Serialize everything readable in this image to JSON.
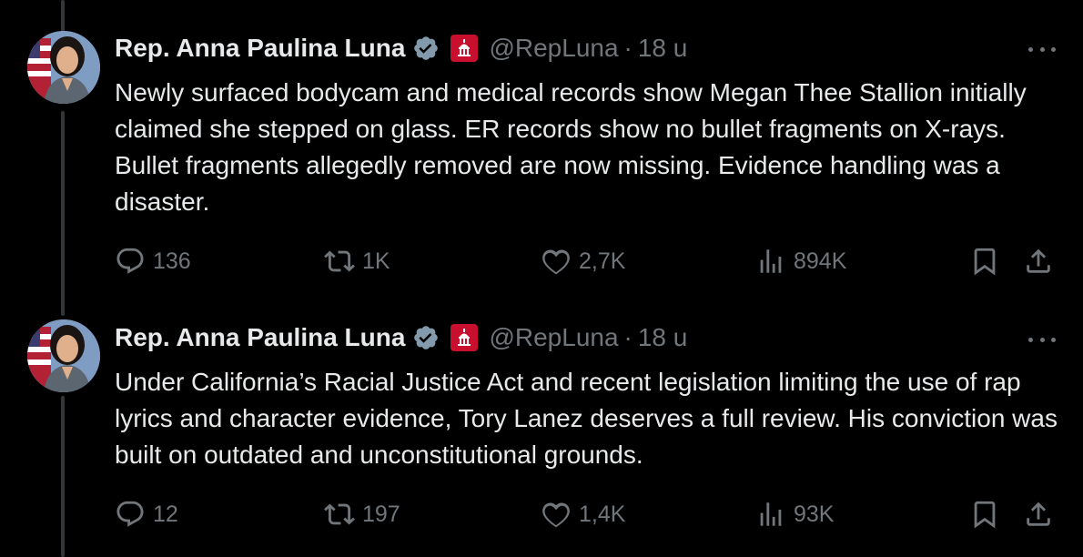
{
  "tweets": [
    {
      "name": "Rep. Anna Paulina Luna",
      "handle": "@RepLuna",
      "separator": "·",
      "time": "18 u",
      "text": "Newly surfaced bodycam and medical records show Megan Thee Stallion initially claimed she stepped on glass. ER records show no bullet fragments on X-rays. Bullet fragments allegedly removed are now missing. Evidence handling was a disaster.",
      "replies": "136",
      "reposts": "1K",
      "likes": "2,7K",
      "views": "894K"
    },
    {
      "name": "Rep. Anna Paulina Luna",
      "handle": "@RepLuna",
      "separator": "·",
      "time": "18 u",
      "text": "Under California’s Racial Justice Act and recent legislation limiting the use of rap lyrics and character evidence, Tory Lanez deserves a full review. His conviction was built on outdated and unconstitutional grounds.",
      "replies": "12",
      "reposts": "197",
      "likes": "1,4K",
      "views": "93K"
    }
  ],
  "icons": {
    "more": "more-dots-icon",
    "verified": "verified-badge-icon",
    "government": "capitol-flag-icon",
    "reply": "reply-icon",
    "repost": "repost-icon",
    "like": "heart-icon",
    "views": "views-icon",
    "bookmark": "bookmark-icon",
    "share": "share-icon"
  },
  "colors": {
    "background": "#000000",
    "text": "#e7e9ea",
    "muted": "#71767b",
    "thread_line": "#333639",
    "flag_red": "#c8102e"
  }
}
